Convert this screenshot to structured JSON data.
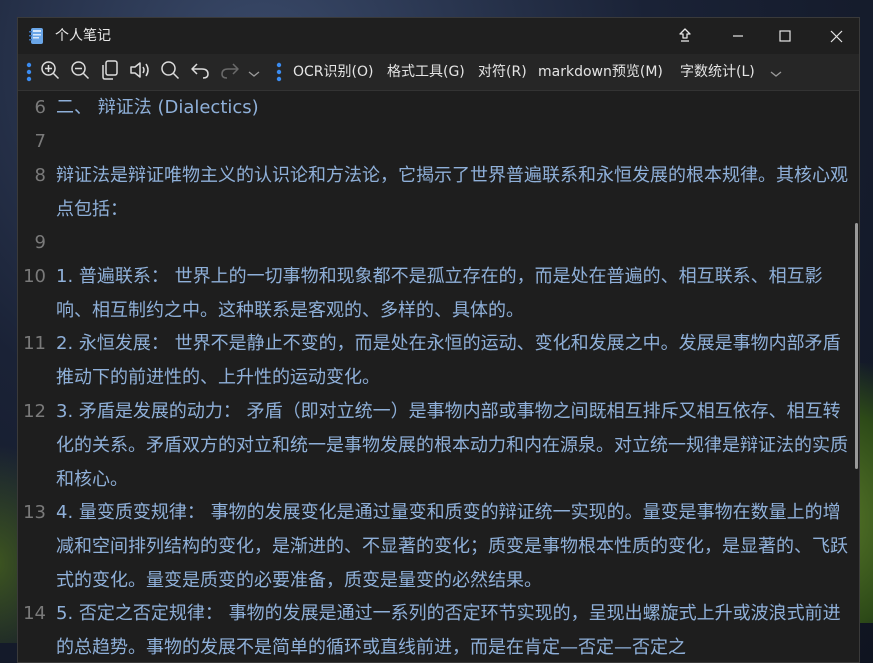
{
  "window": {
    "title": "个人笔记",
    "icons": {
      "app": "notebook-icon",
      "pin": "pin-icon",
      "minimize": "minimize-icon",
      "maximize": "maximize-icon",
      "close": "close-icon"
    }
  },
  "toolbar": {
    "icons": [
      "zoom-in-icon",
      "zoom-out-icon",
      "copy-icon",
      "speaker-icon",
      "search-icon",
      "undo-icon",
      "redo-icon"
    ],
    "menus": {
      "ocr": "OCR识别(O)",
      "format": "格式工具(G)",
      "align": "对符(R)",
      "markdown": "markdown预览(M)",
      "wordcount": "字数统计(L)"
    }
  },
  "editor": {
    "lines": [
      {
        "num": "6",
        "text": "二、 辩证法 (Dialectics)"
      },
      {
        "num": "7",
        "text": ""
      },
      {
        "num": "8",
        "text": "辩证法是辩证唯物主义的认识论和方法论，它揭示了世界普遍联系和永恒发展的根本规律。其核心观点包括："
      },
      {
        "num": "9",
        "text": ""
      },
      {
        "num": "10",
        "text": "1. 普遍联系： 世界上的一切事物和现象都不是孤立存在的，而是处在普遍的、相互联系、相互影响、相互制约之中。这种联系是客观的、多样的、具体的。"
      },
      {
        "num": "11",
        "text": "2. 永恒发展： 世界不是静止不变的，而是处在永恒的运动、变化和发展之中。发展是事物内部矛盾推动下的前进性的、上升性的运动变化。"
      },
      {
        "num": "12",
        "text": "3. 矛盾是发展的动力： 矛盾（即对立统一）是事物内部或事物之间既相互排斥又相互依存、相互转化的关系。矛盾双方的对立和统一是事物发展的根本动力和内在源泉。对立统一规律是辩证法的实质和核心。"
      },
      {
        "num": "13",
        "text": "4. 量变质变规律： 事物的发展变化是通过量变和质变的辩证统一实现的。量变是事物在数量上的增减和空间排列结构的变化，是渐进的、不显著的变化；质变是事物根本性质的变化，是显著的、飞跃式的变化。量变是质变的必要准备，质变是量变的必然结果。"
      },
      {
        "num": "14",
        "text": "5. 否定之否定规律： 事物的发展是通过一系列的否定环节实现的，呈现出螺旋式上升或波浪式前进的总趋势。事物的发展不是简单的循环或直线前进，而是在肯定—否定—否定之"
      }
    ]
  }
}
